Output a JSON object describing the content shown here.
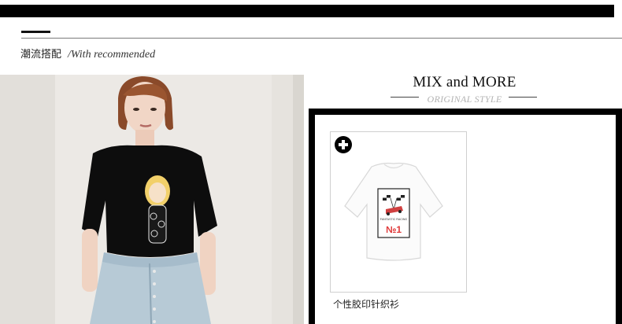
{
  "section": {
    "title_cn": "潮流搭配",
    "title_en": "/With recommended"
  },
  "mix": {
    "title": "MIX and MORE",
    "subtitle": "ORIGINAL STYLE"
  },
  "product": {
    "name": "个性胶印针织衫",
    "add_icon": "plus-circle-icon",
    "print_text": "FANTASTIC RACING",
    "print_number": "№1"
  },
  "colors": {
    "bar": "#000000",
    "subtitle": "#b3b3b3",
    "print_red": "#e03a3a"
  }
}
